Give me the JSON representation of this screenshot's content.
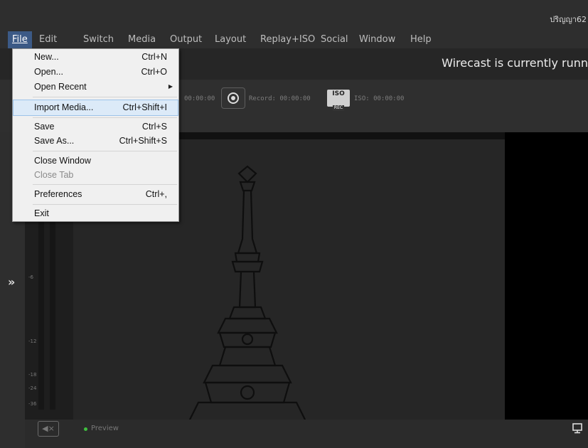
{
  "titlebar": {
    "user": "ปริญญา62"
  },
  "menubar": {
    "items": [
      "File",
      "Edit",
      "Switch",
      "Media",
      "Output",
      "Layout",
      "Replay+ISO",
      "Social",
      "Window",
      "Help"
    ]
  },
  "status": {
    "message": "Wirecast is currently runn"
  },
  "toolbar": {
    "stream_time": "00:00:00",
    "record_time": "Record: 00:00:00",
    "iso_label": "ISO",
    "iso_rec": "REC",
    "iso_time": "ISO: 00:00:00"
  },
  "file_menu": {
    "new": {
      "label": "New...",
      "shortcut": "Ctrl+N"
    },
    "open": {
      "label": "Open...",
      "shortcut": "Ctrl+O"
    },
    "open_recent": {
      "label": "Open Recent"
    },
    "import_media": {
      "label": "Import Media...",
      "shortcut": "Ctrl+Shift+I"
    },
    "save": {
      "label": "Save",
      "shortcut": "Ctrl+S"
    },
    "save_as": {
      "label": "Save As...",
      "shortcut": "Ctrl+Shift+S"
    },
    "close_window": {
      "label": "Close Window"
    },
    "close_tab": {
      "label": "Close Tab"
    },
    "preferences": {
      "label": "Preferences",
      "shortcut": "Ctrl+,"
    },
    "exit": {
      "label": "Exit"
    }
  },
  "audio_meter": {
    "marks": [
      "-6",
      "-12",
      "-18",
      "-24",
      "-36"
    ]
  },
  "preview": {
    "label": "Preview"
  },
  "sidebar": {
    "expand": "»"
  },
  "icons": [
    "record-icon",
    "iso-rec-icon",
    "mute-speaker-icon",
    "monitor-icon",
    "submenu-arrow-icon"
  ],
  "colors": {
    "menu_active": "#3c5a86",
    "menu_highlight": "#dceaf8",
    "preview_dot": "#3fbf3f"
  }
}
